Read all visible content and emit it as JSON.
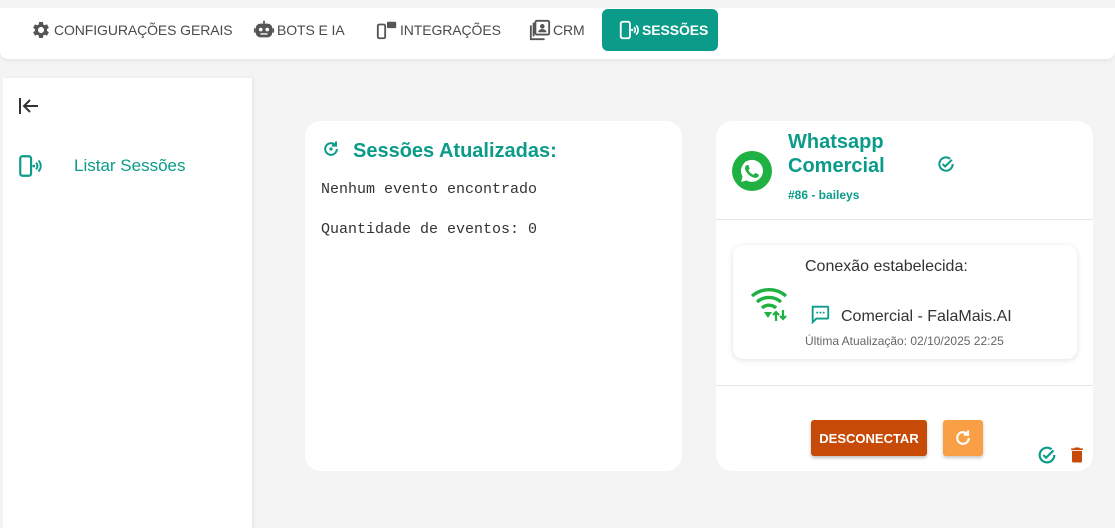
{
  "tabs": [
    {
      "label": "CONFIGURAÇÕES GERAIS",
      "icon": "gear-icon"
    },
    {
      "label": "BOTS E IA",
      "icon": "robot-icon"
    },
    {
      "label": "INTEGRAÇÕES",
      "icon": "devices-icon"
    },
    {
      "label": "CRM",
      "icon": "contacts-icon"
    },
    {
      "label": "SESSÕES",
      "icon": "phone-signal-icon",
      "active": true
    }
  ],
  "sidebar": {
    "items": [
      {
        "label": "Listar Sessões",
        "icon": "phone-signal-icon"
      }
    ]
  },
  "events_card": {
    "title": "Sessões Atualizadas:",
    "empty_message": "Nenhum evento encontrado",
    "count_text": "Quantidade de eventos: 0"
  },
  "session_card": {
    "name": "Whatsapp Comercial",
    "subtitle": "#86 - baileys",
    "connection": {
      "status": "Conexão estabelecida:",
      "session_name": "Comercial - FalaMais.AI",
      "last_update": "Última Atualização: 02/10/2025 22:25"
    },
    "disconnect_label": "DESCONECTAR"
  },
  "colors": {
    "accent": "#0b9b89",
    "whatsapp_green": "#1fb141",
    "disconnect": "#c74b06",
    "refresh": "#f9a046",
    "delete": "#c74b06"
  }
}
